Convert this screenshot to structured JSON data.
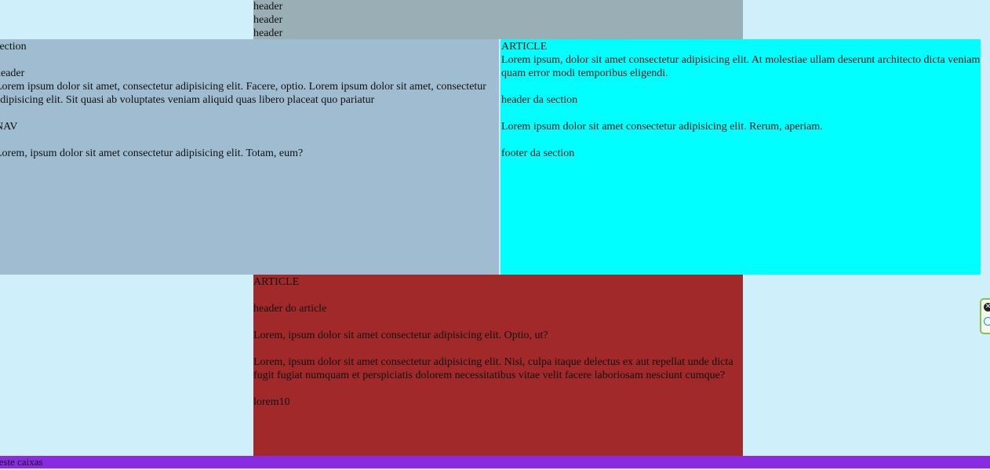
{
  "top_header": {
    "lines": [
      "header",
      "header",
      "header"
    ]
  },
  "left_section": {
    "title": "section",
    "header": "header",
    "paragraph": "Lorem ipsum dolor sit amet, consectetur adipisicing elit. Facere, optio. Lorem ipsum dolor sit amet, consectetur adipisicing elit. Sit quasi ab voluptates veniam aliquid quas libero placeat quo pariatur",
    "nav": "NAV",
    "nav_text": "Lorem, ipsum dolor sit amet consectetur adipisicing elit. Totam, eum?"
  },
  "right_article": {
    "title": "ARTICLE",
    "paragraph": "Lorem ipsum, dolor sit amet consectetur adipisicing elit. At molestiae ullam deserunt architecto dicta veniam quam error modi temporibus eligendi.",
    "section_header": "header da section",
    "section_text": "Lorem ipsum dolor sit amet consectetur adipisicing elit. Rerum, aperiam.",
    "section_footer": "footer da section"
  },
  "bottom_article": {
    "title": "ARTICLE",
    "header": "header do article",
    "paragraph1": "Lorem, ipsum dolor sit amet consectetur adipisicing elit. Optio, ut?",
    "paragraph2": "Lorem, ipsum dolor sit amet consectetur adipisicing elit. Nisi, culpa itaque delectus ex aut repellat unde dicta fugit fugiat numquam et perspiciatis dolorem necessitatibus vitae velit facere laboriosam nesciunt cumque?",
    "footer": "lorem10"
  },
  "footer_bar": {
    "text": "teste caixas"
  },
  "floating_widget": {
    "close_icon": "close-circle-icon",
    "info_icon": "info-circle-icon"
  },
  "colors": {
    "page_background": "#cfeffb",
    "top_header": "#9aaeb5",
    "left_section": "#a0bcd0",
    "right_article": "#00ffff",
    "bottom_article": "#a1292a",
    "footer_bar": "#8a2be2"
  }
}
